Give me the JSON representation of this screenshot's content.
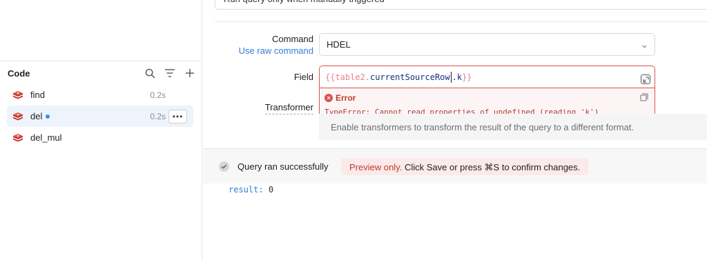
{
  "sidebar": {
    "code_title": "Code",
    "queries": [
      {
        "name": "find",
        "time": "0.2s",
        "selected": false,
        "unsaved": false
      },
      {
        "name": "del",
        "time": "0.2s",
        "selected": true,
        "unsaved": true
      },
      {
        "name": "del_mul",
        "time": "",
        "selected": false,
        "unsaved": false
      }
    ],
    "more_label": "•••"
  },
  "main": {
    "top_input_value": "Run query only when manually triggered",
    "command": {
      "label": "Command",
      "raw_link": "Use raw command",
      "value": "HDEL"
    },
    "field": {
      "label": "Field",
      "open_brace": "{{",
      "object": "table2.",
      "property": "currentSourceRow",
      "after_caret": ".k",
      "close_brace": "}}"
    },
    "error": {
      "title": "Error",
      "message": "TypeError: Cannot read properties of undefined (reading 'k')"
    },
    "transformer": {
      "label": "Transformer",
      "description": "Enable transformers to transform the result of the query to a different format."
    },
    "status": {
      "text": "Query ran successfully",
      "preview_red": "Preview only.",
      "preview_rest": " Click Save or press  ⌘S to confirm changes."
    },
    "result": {
      "key": "result:",
      "value": "0"
    }
  },
  "colors": {
    "accent": "#2f7fd9",
    "error": "#d9534f",
    "redis": "#c9302c",
    "selected_bg": "#edf4fc"
  }
}
